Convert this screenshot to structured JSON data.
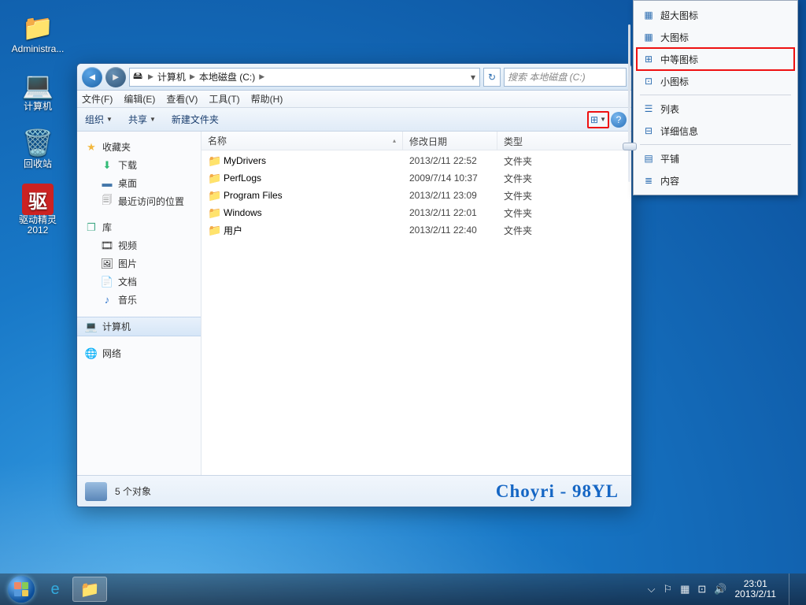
{
  "desktop": {
    "icons": [
      {
        "label": "Administra...",
        "glyph": "📁"
      },
      {
        "label": "计算机",
        "glyph": "💻"
      },
      {
        "label": "回收站",
        "glyph": "🗑️"
      },
      {
        "label": "驱动精灵\n2012",
        "glyph": "驱"
      }
    ]
  },
  "window": {
    "breadcrumbs": [
      "计算机",
      "本地磁盘 (C:)"
    ],
    "search_placeholder": "搜索 本地磁盘 (C:)",
    "menu": [
      "文件(F)",
      "编辑(E)",
      "查看(V)",
      "工具(T)",
      "帮助(H)"
    ],
    "toolbar": {
      "organize": "组织",
      "share": "共享",
      "newfolder": "新建文件夹"
    },
    "sidebar": {
      "favorites": {
        "title": "收藏夹",
        "items": [
          "下载",
          "桌面",
          "最近访问的位置"
        ]
      },
      "libraries": {
        "title": "库",
        "items": [
          "视频",
          "图片",
          "文档",
          "音乐"
        ]
      },
      "computer": {
        "title": "计算机"
      },
      "network": {
        "title": "网络"
      }
    },
    "columns": {
      "name": "名称",
      "date": "修改日期",
      "type": "类型"
    },
    "rows": [
      {
        "name": "MyDrivers",
        "date": "2013/2/11 22:52",
        "type": "文件夹"
      },
      {
        "name": "PerfLogs",
        "date": "2009/7/14 10:37",
        "type": "文件夹"
      },
      {
        "name": "Program Files",
        "date": "2013/2/11 23:09",
        "type": "文件夹"
      },
      {
        "name": "Windows",
        "date": "2013/2/11 22:01",
        "type": "文件夹"
      },
      {
        "name": "用户",
        "date": "2013/2/11 22:40",
        "type": "文件夹"
      }
    ],
    "status": {
      "count": "5 个对象",
      "brand": "Choyri - 98YL"
    }
  },
  "view_menu": {
    "items": [
      "超大图标",
      "大图标",
      "中等图标",
      "小图标",
      "列表",
      "详细信息",
      "平铺",
      "内容"
    ],
    "highlighted": "中等图标"
  },
  "taskbar": {
    "time": "23:01",
    "date": "2013/2/11"
  }
}
